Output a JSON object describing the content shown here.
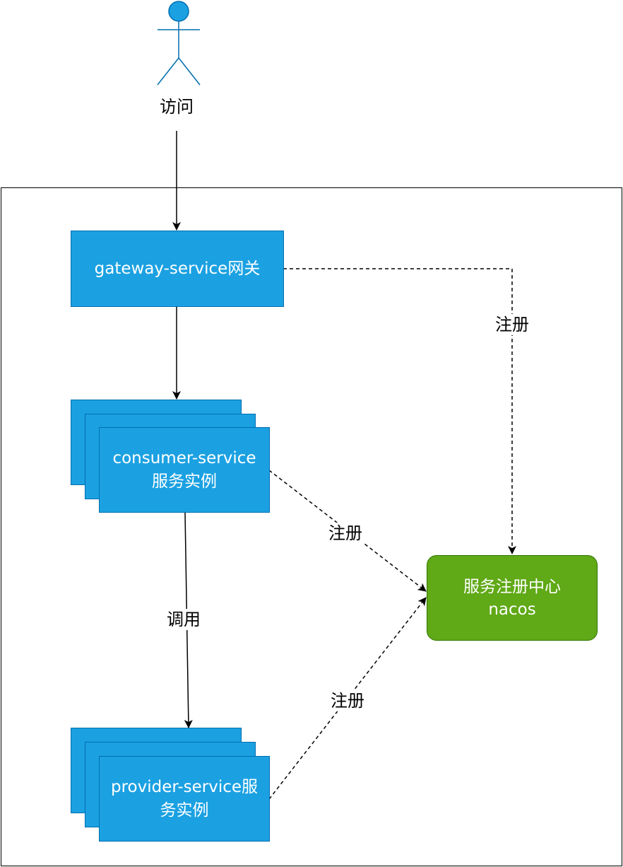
{
  "actor": {
    "label": "访问"
  },
  "gateway": {
    "label": "gateway-service网关"
  },
  "consumer": {
    "line1": "consumer-service",
    "line2": "服务实例"
  },
  "provider": {
    "line1": "provider-service服",
    "line2": "务实例"
  },
  "registry": {
    "line1": "服务注册中心",
    "line2": "nacos"
  },
  "edges": {
    "gateway_register": "注册",
    "consumer_register": "注册",
    "provider_register": "注册",
    "consumer_calls_provider": "调用"
  },
  "colors": {
    "service_fill": "#1ba1e2",
    "service_border": "#006eaf",
    "registry_fill": "#60a917",
    "registry_border": "#2d7600",
    "actor_fill": "#1ba1e2"
  }
}
